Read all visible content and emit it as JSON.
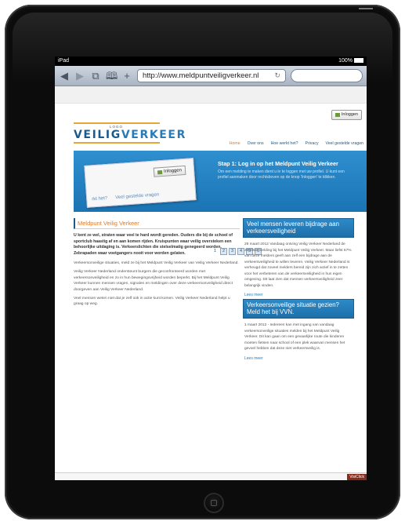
{
  "status": {
    "left": "iPad",
    "right": "100%"
  },
  "browser": {
    "url": "http://www.meldpuntveiligverkeer.nl",
    "icons": [
      "back-icon",
      "forward-icon",
      "tabs-icon",
      "bookmarks-icon",
      "add-icon",
      "reload-icon"
    ]
  },
  "site": {
    "login_label": "Inloggen",
    "logo": {
      "top": "LOGO",
      "veilig": "VEILIG",
      "verkeer": "VERKEER"
    },
    "nav": [
      "Home",
      "Over ons",
      "Hoe werkt het?",
      "Privacy",
      "Veel gestelde vragen"
    ],
    "banner": {
      "title": "Stap 1: Log in op het Meldpunt Veilig Verkeer",
      "text": "Om een melding te maken dient u in te loggen met uw profiel. U kunt een profiel aanmaken door rechtsboven op de knop 'Inloggen' te klikken.",
      "shot_login": "Inloggen",
      "shot_nav": [
        "rkt het?",
        "Veel gestelde vragen"
      ],
      "pages": [
        "1",
        "2",
        "3",
        "4",
        "5",
        "6"
      ]
    },
    "main": {
      "title": "Meldpunt Veilig Verkeer",
      "lead": "U kent ze wel, straten waar veel te hard wordt gereden. Ouders die bij de school of sportclub haastig af en aan komen rijden. Kruispunten waar veilig oversteken een behoorlijke uitdaging is. Verkeerslichten die stelselmatig genegeerd worden. Zebrapaden waar voetgangers nooit voor worden gelaten.",
      "paragraphs": [
        "Verkeersonveilige situaties, meld ze bij het Meldpunt Veilig Verkeer van Veilig Verkeer Nederland.",
        "Veilig Verkeer Nederland ondersteunt burgers die geconfronteerd worden met verkeersonveiligheid en zo in hun bewegingsvrijheid worden beperkt. Bij het Meldpunt Veilig Verkeer kunnen mensen vragen, signalen en meldingen over deze verkeersonveiligheid direct doorgeven aan Veilig Verkeer Nederland.",
        "Veel mensen weten niet dat je zelf ook in actie kunt komen. Veilig Verkeer Nederland helpt u graag op weg."
      ]
    },
    "side": [
      {
        "title": "Veel mensen leveren bijdrage aan verkeersveiligheid",
        "text": "29 maart 2012 Vandaag ontving Veilig Verkeer Nederland de 2500ste melding bij het Meldpunt Veilig Verkeer. Maar liefst 67% van deze melders geeft aan zelf een bijdrage aan de verkeersveiligheid te willen leveren. Veilig Verkeer Nederland is verheugd dat zoveel melders bereid zijn zich actief in te zetten voor het verbeteren van de verkeersveiligheid in hun eigen omgeving. Dit laat zien dat mensen verkeersveiligheid zeer belangrijk vinden.",
        "link": "Lees meer"
      },
      {
        "title": "Verkeersonveilige situatie gezien? Meld het bij VVN.",
        "text": "1 maart 2012 - Iedereen kan met ingang van vandaag verkeersonveilige situaties melden bij het Meldpunt Veilig Verkeer. Dit kan gaan om een gevaarlijke route die kinderen moeten fietsen naar school of een plek waarvan mensen het gevoel hebben dat deze niet verkeersveilig is.",
        "link": "Lees meer"
      }
    ],
    "footer_badge": "VisiClick"
  }
}
